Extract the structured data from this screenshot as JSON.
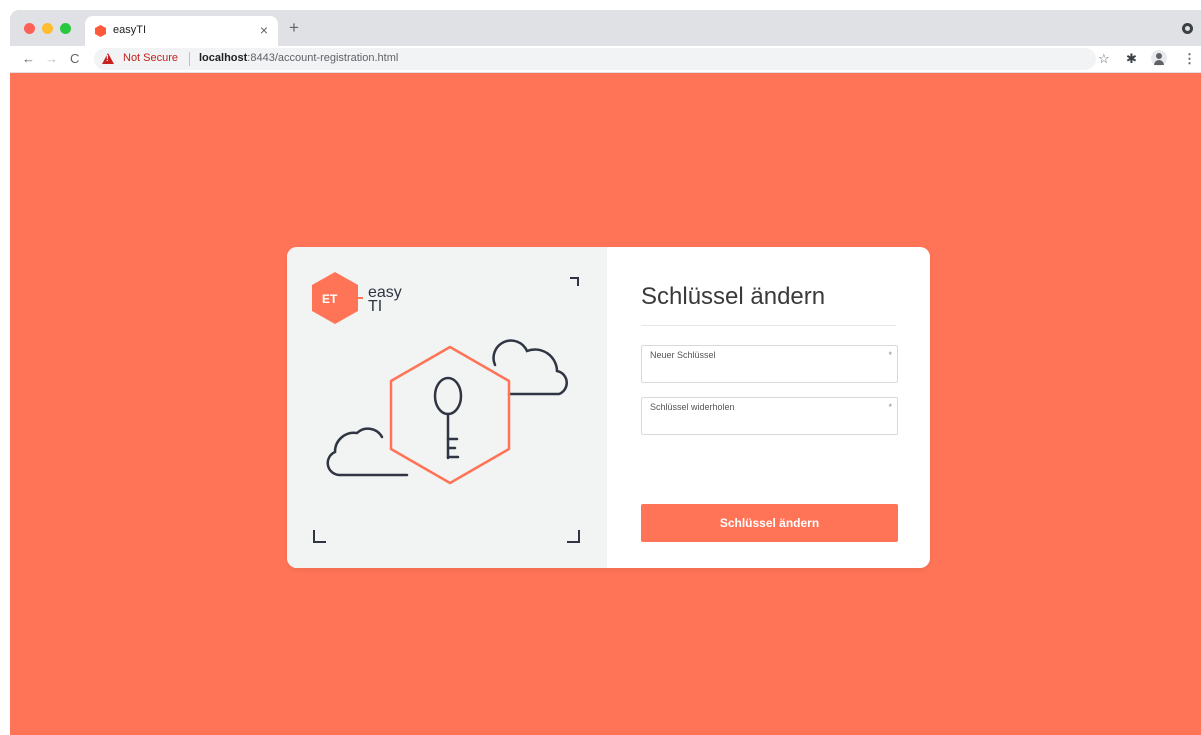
{
  "browser": {
    "tab_title": "easyTI",
    "tab_close": "×",
    "new_tab": "+",
    "security_label": "Not Secure",
    "url_host": "localhost",
    "url_rest": ":8443/account-registration.html",
    "nav_back": "←",
    "nav_forward": "→",
    "nav_reload": "C",
    "star": "☆",
    "extensions": "✱",
    "menu": "⋮"
  },
  "brand": {
    "logo_badge": "ET",
    "logo_line1": "easy",
    "logo_line2": "TI",
    "accent_color": "#ff7457",
    "dark_color": "#2f3542"
  },
  "illustration": {
    "icons": [
      "hexagon-frame",
      "key-icon",
      "cloud-icon",
      "cloud-icon",
      "corner-brackets"
    ]
  },
  "form": {
    "title": "Schlüssel ändern",
    "fields": [
      {
        "label": "Neuer Schlüssel",
        "required_mark": "*",
        "value": ""
      },
      {
        "label": "Schlüssel widerholen",
        "required_mark": "*",
        "value": ""
      }
    ],
    "submit_label": "Schlüssel ändern"
  }
}
